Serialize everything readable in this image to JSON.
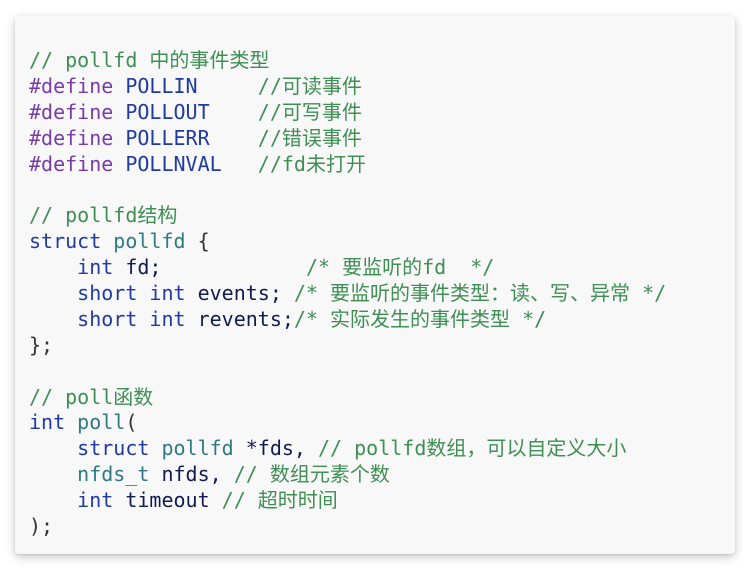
{
  "code_block": {
    "lines": [
      [
        {
          "text": "// pollfd 中的事件类型",
          "cls": "cmt"
        }
      ],
      [
        {
          "text": "#define",
          "cls": "kw"
        },
        {
          "text": " POLLIN     ",
          "cls": "ty"
        },
        {
          "text": "//可读事件",
          "cls": "cmt"
        }
      ],
      [
        {
          "text": "#define",
          "cls": "kw"
        },
        {
          "text": " POLLOUT    ",
          "cls": "ty"
        },
        {
          "text": "//可写事件",
          "cls": "cmt"
        }
      ],
      [
        {
          "text": "#define",
          "cls": "kw"
        },
        {
          "text": " POLLERR    ",
          "cls": "ty"
        },
        {
          "text": "//错误事件",
          "cls": "cmt"
        }
      ],
      [
        {
          "text": "#define",
          "cls": "kw"
        },
        {
          "text": " POLLNVAL   ",
          "cls": "ty"
        },
        {
          "text": "//fd未打开",
          "cls": "cmt"
        }
      ],
      [],
      [
        {
          "text": "// pollfd结构",
          "cls": "cmt"
        }
      ],
      [
        {
          "text": "struct",
          "cls": "ty"
        },
        {
          "text": " ",
          "cls": "pn"
        },
        {
          "text": "pollfd",
          "cls": "tn"
        },
        {
          "text": " {",
          "cls": "pn"
        }
      ],
      [
        {
          "text": "    int",
          "cls": "ty"
        },
        {
          "text": " fd;            ",
          "cls": "id"
        },
        {
          "text": "/* 要监听的fd  */",
          "cls": "cmt"
        }
      ],
      [
        {
          "text": "    short int",
          "cls": "ty"
        },
        {
          "text": " events; ",
          "cls": "id"
        },
        {
          "text": "/* 要监听的事件类型：读、写、异常 */",
          "cls": "cmt"
        }
      ],
      [
        {
          "text": "    short int",
          "cls": "ty"
        },
        {
          "text": " revents;",
          "cls": "id"
        },
        {
          "text": "/* 实际发生的事件类型 */",
          "cls": "cmt"
        }
      ],
      [
        {
          "text": "};",
          "cls": "pn"
        }
      ],
      [],
      [
        {
          "text": "// poll函数",
          "cls": "cmt"
        }
      ],
      [
        {
          "text": "int",
          "cls": "ty"
        },
        {
          "text": " ",
          "cls": "pn"
        },
        {
          "text": "poll",
          "cls": "tn"
        },
        {
          "text": "(",
          "cls": "pn"
        }
      ],
      [
        {
          "text": "    struct",
          "cls": "ty"
        },
        {
          "text": " ",
          "cls": "pn"
        },
        {
          "text": "pollfd",
          "cls": "tn"
        },
        {
          "text": " *fds, ",
          "cls": "id"
        },
        {
          "text": "// pollfd数组，可以自定义大小",
          "cls": "cmt"
        }
      ],
      [
        {
          "text": "    nfds_t",
          "cls": "tn"
        },
        {
          "text": " nfds, ",
          "cls": "id"
        },
        {
          "text": "// 数组元素个数",
          "cls": "cmt"
        }
      ],
      [
        {
          "text": "    int",
          "cls": "ty"
        },
        {
          "text": " timeout ",
          "cls": "id"
        },
        {
          "text": "// 超时时间",
          "cls": "cmt"
        }
      ],
      [
        {
          "text": ");",
          "cls": "pn"
        }
      ]
    ]
  }
}
